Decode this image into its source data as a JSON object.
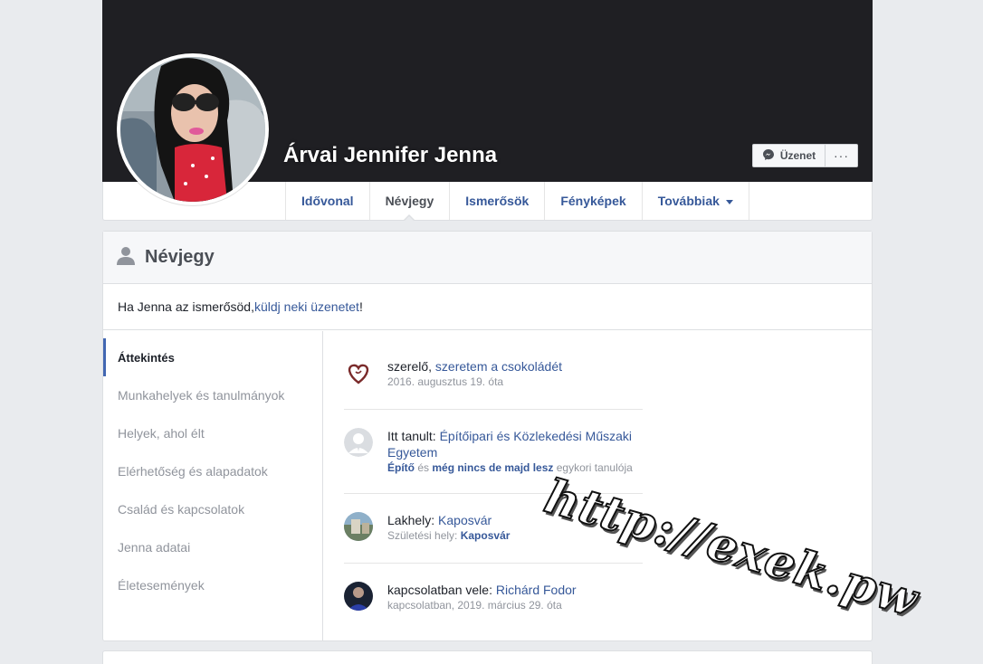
{
  "profile": {
    "name": "Árvai Jennifer Jenna",
    "message_button": "Üzenet",
    "more_button": "···"
  },
  "nav": {
    "tabs": [
      {
        "label": "Idővonal"
      },
      {
        "label": "Névjegy"
      },
      {
        "label": "Ismerősök"
      },
      {
        "label": "Fényképek"
      },
      {
        "label": "Továbbiak"
      }
    ],
    "active": "Névjegy"
  },
  "about": {
    "title": "Névjegy",
    "intro_prefix": "Ha Jenna az ismerősöd, ",
    "intro_link": "küldj neki üzenetet",
    "intro_suffix": "!",
    "sidebar": [
      {
        "label": "Áttekintés"
      },
      {
        "label": "Munkahelyek és tanulmányok"
      },
      {
        "label": "Helyek, ahol élt"
      },
      {
        "label": "Elérhetőség és alapadatok"
      },
      {
        "label": "Család és kapcsolatok"
      },
      {
        "label": "Jenna adatai"
      },
      {
        "label": "Életesemények"
      }
    ],
    "entries": {
      "job": {
        "prefix": "szerelő, ",
        "link": "szeretem a csokoládét",
        "sub": "2016. augusztus 19. óta"
      },
      "school": {
        "prefix": "Itt tanult: ",
        "link": "Építőipari és Közlekedési Műszaki Egyetem",
        "sub_a": "Építő",
        "sub_mid": " és ",
        "sub_b": "még nincs de majd lesz",
        "sub_end": " egykori tanulója"
      },
      "home": {
        "prefix": "Lakhely: ",
        "link": "Kaposvár",
        "sub_prefix": "Születési hely: ",
        "sub_link": "Kaposvár"
      },
      "relation": {
        "prefix": "kapcsolatban vele: ",
        "link": "Richárd Fodor",
        "sub": "kapcsolatban, 2019. március 29. óta"
      }
    }
  },
  "watermark": "http://exek.pw",
  "colors": {
    "link": "#365899",
    "cover": "#1f1f23",
    "accent": "#4267b2"
  }
}
